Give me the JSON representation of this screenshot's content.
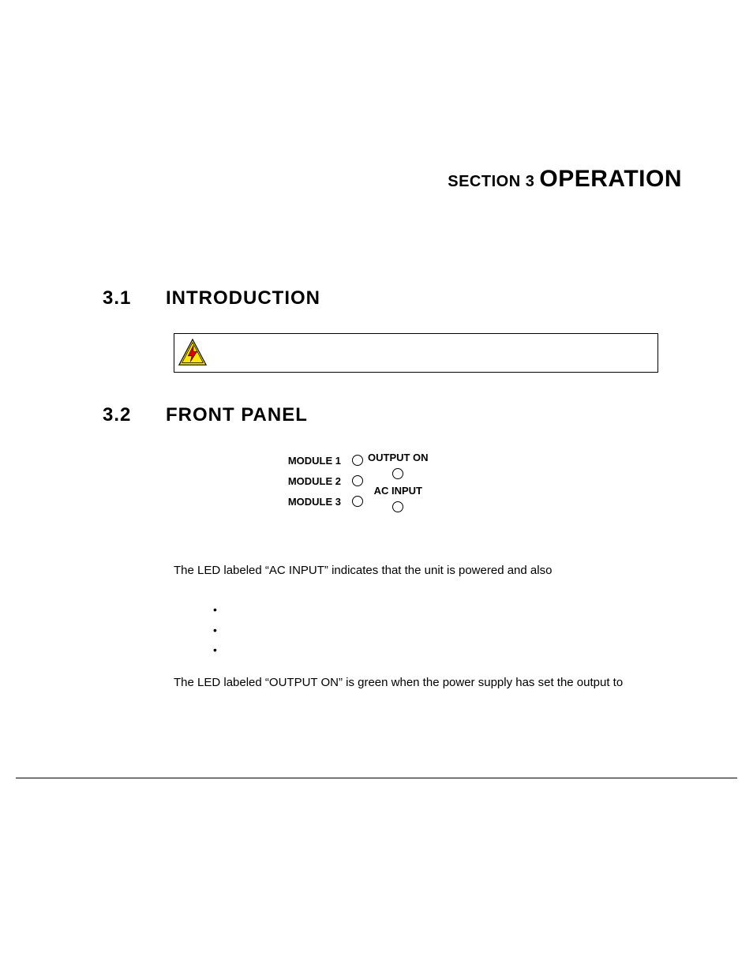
{
  "section": {
    "prefix": "SECTION 3 ",
    "title": "OPERATION"
  },
  "headings": {
    "h1": {
      "num": "3.1",
      "text": "INTRODUCTION"
    },
    "h2": {
      "num": "3.2",
      "text": "FRONT PANEL"
    }
  },
  "panel": {
    "module1": "MODULE 1",
    "module2": "MODULE 2",
    "module3": "MODULE 3",
    "output_on": "OUTPUT ON",
    "ac_input": "AC INPUT"
  },
  "body": {
    "p1": "The LED labeled “AC INPUT” indicates that the unit is powered and also",
    "p2": "The LED labeled “OUTPUT ON” is green when the power supply has set the output to"
  }
}
